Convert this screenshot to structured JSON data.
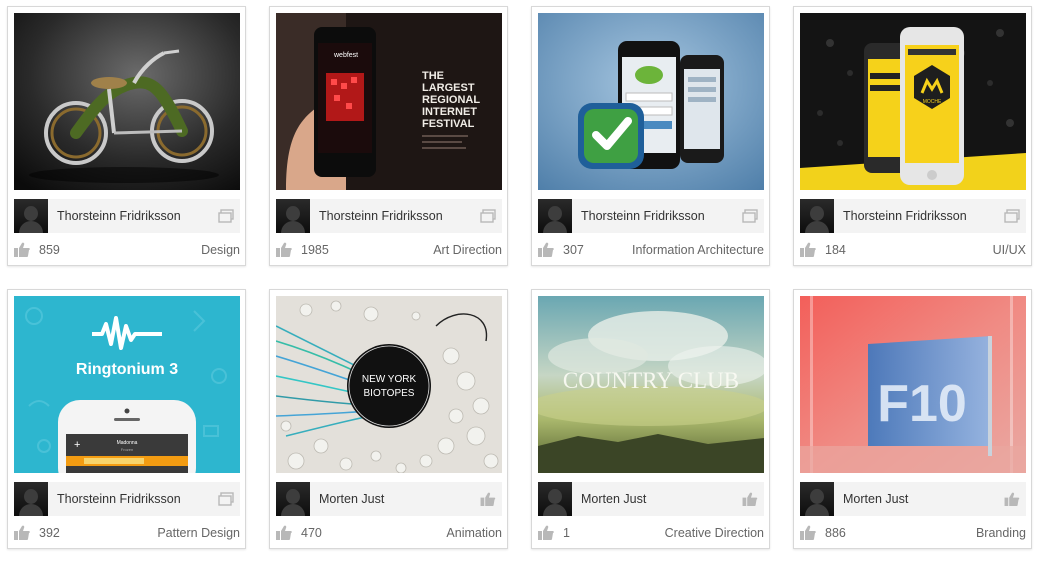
{
  "colors": {
    "card_border": "#d8d8d8",
    "author_bar": "#f3f3f3",
    "icon_gray": "#b8b8b8"
  },
  "cards": [
    {
      "author": "Thorsteinn Fridriksson",
      "likes": "859",
      "category": "Design",
      "type_icon": "gallery-icon",
      "thumb": "bicycle-photo"
    },
    {
      "author": "Thorsteinn Fridriksson",
      "likes": "1985",
      "category": "Art Direction",
      "type_icon": "gallery-icon",
      "thumb": "webfest-phone-photo",
      "thumb_text": {
        "phone_logo": "webfest",
        "headline": [
          "THE",
          "LARGEST",
          "REGIONAL",
          "INTERNET",
          "FESTIVAL"
        ]
      }
    },
    {
      "author": "Thorsteinn Fridriksson",
      "likes": "307",
      "category": "Information Architecture",
      "type_icon": "gallery-icon",
      "thumb": "checkmark-app-phones"
    },
    {
      "author": "Thorsteinn Fridriksson",
      "likes": "184",
      "category": "UI/UX",
      "type_icon": "gallery-icon",
      "thumb": "yellow-phone-app",
      "thumb_text": {
        "brand": "MOCHE"
      }
    },
    {
      "author": "Thorsteinn Fridriksson",
      "likes": "392",
      "category": "Pattern Design",
      "type_icon": "gallery-icon",
      "thumb": "ringtonium-poster",
      "thumb_text": {
        "title": "Ringtonium 3",
        "phone_track": "Madonna",
        "phone_artist": "Frozen"
      }
    },
    {
      "author": "Morten Just",
      "likes": "470",
      "category": "Animation",
      "type_icon": "like-icon",
      "thumb": "biotopes-artwork",
      "thumb_text": {
        "line1": "NEW YORK",
        "line2": "BIOTOPES"
      }
    },
    {
      "author": "Morten Just",
      "likes": "1",
      "category": "Creative Direction",
      "type_icon": "like-icon",
      "thumb": "country-club-landscape",
      "thumb_text": {
        "title": "COUNTRY CLUB"
      }
    },
    {
      "author": "Morten Just",
      "likes": "886",
      "category": "Branding",
      "type_icon": "like-icon",
      "thumb": "f10-sign-photo",
      "thumb_text": {
        "sign": "F10"
      }
    }
  ]
}
